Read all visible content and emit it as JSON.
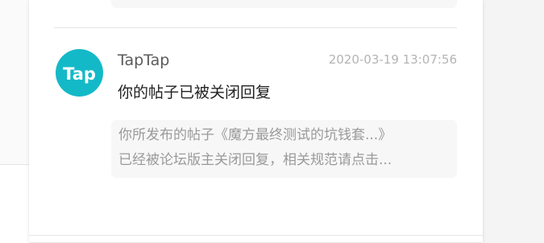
{
  "notification": {
    "sender": "TapTap",
    "timestamp": "2020-03-19 13:07:56",
    "title": "你的帖子已被关闭回复",
    "snippet_lines": [
      "你所发布的帖子《魔方最终测试的坑钱套...》",
      "已经被论坛版主关闭回复，相关规范请点击..."
    ],
    "avatar": {
      "text": "Tap",
      "icon": "taptap-logo-icon",
      "color": "#14b9c8"
    }
  }
}
